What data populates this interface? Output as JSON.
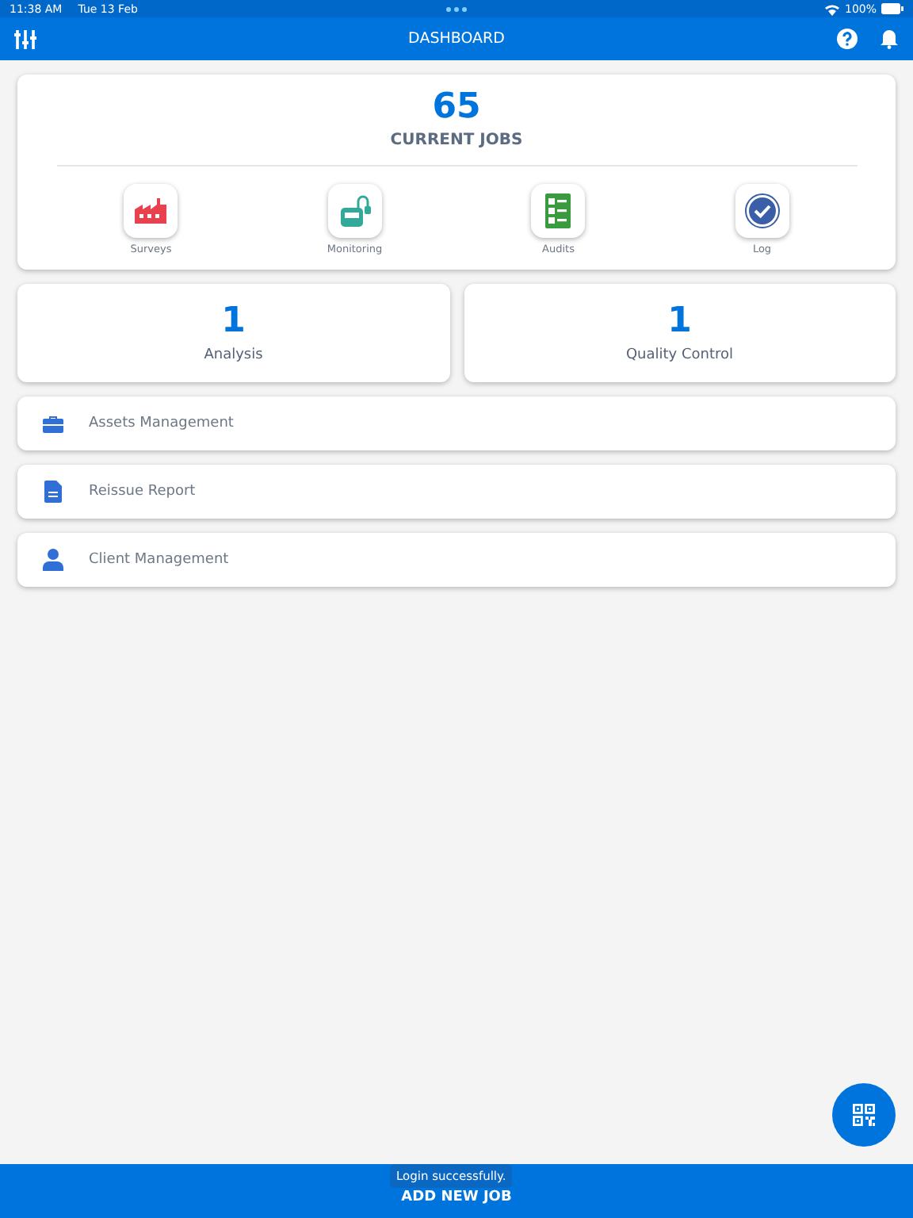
{
  "status_bar": {
    "time": "11:38 AM",
    "date": "Tue 13 Feb",
    "battery": "100%"
  },
  "header": {
    "title": "DASHBOARD"
  },
  "jobs": {
    "count": "65",
    "label": "CURRENT JOBS",
    "shortcuts": [
      {
        "label": "Surveys",
        "kind": "factory"
      },
      {
        "label": "Monitoring",
        "kind": "device"
      },
      {
        "label": "Audits",
        "kind": "checklist"
      },
      {
        "label": "Log",
        "kind": "badge"
      }
    ]
  },
  "stats": [
    {
      "count": "1",
      "label": "Analysis"
    },
    {
      "count": "1",
      "label": "Quality Control"
    }
  ],
  "menu": [
    {
      "label": "Assets Management",
      "kind": "briefcase"
    },
    {
      "label": "Reissue Report",
      "kind": "document"
    },
    {
      "label": "Client Management",
      "kind": "person"
    }
  ],
  "bottom_button": "ADD NEW JOB",
  "toast": "Login successfully."
}
